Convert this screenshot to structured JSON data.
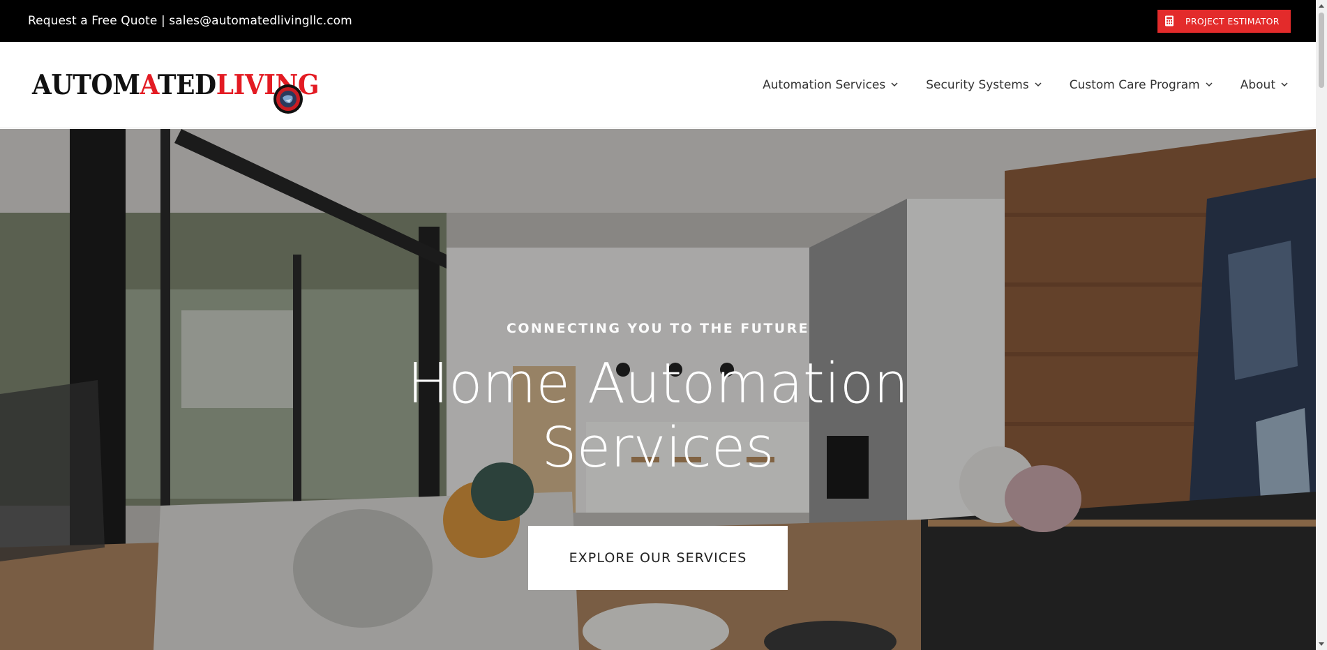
{
  "topbar": {
    "contact_text": "Request a Free Quote | sales@automatedlivingllc.com",
    "estimator_label": "PROJECT ESTIMATOR"
  },
  "logo": {
    "part1": "AUTOM",
    "part2": "A",
    "part3": "TED",
    "part4": "LIVING"
  },
  "nav": {
    "items": [
      {
        "label": "Automation Services"
      },
      {
        "label": "Security Systems"
      },
      {
        "label": "Custom Care Program"
      },
      {
        "label": "About"
      }
    ]
  },
  "hero": {
    "eyebrow": "CONNECTING YOU TO THE FUTURE",
    "title_line1": "Home Automation",
    "title_line2": "Services",
    "cta_label": "EXPLORE OUR SERVICES"
  },
  "colors": {
    "brand_red": "#e32b2b",
    "topbar_bg": "#000000",
    "text_dark": "#333333"
  }
}
